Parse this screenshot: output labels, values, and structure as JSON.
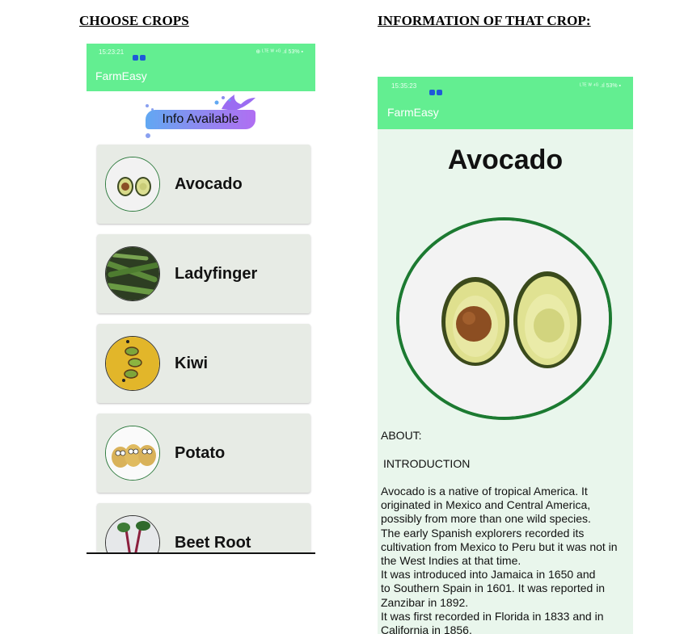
{
  "headings": {
    "left": "CHOOSE CROPS",
    "right": "INFORMATION OF THAT CROP:"
  },
  "list_screen": {
    "status_time": "15:23:21",
    "status_right": "⊕ ᴸᵀᴱ ᵂ ⁴ᴳ .ıl 53% ▪",
    "app_title": "FarmEasy",
    "banner": "Info Available",
    "crops": [
      {
        "name": "Avocado",
        "icon": "avocado-image"
      },
      {
        "name": "Ladyfinger",
        "icon": "okra-image"
      },
      {
        "name": "Kiwi",
        "icon": "kiwi-image"
      },
      {
        "name": "Potato",
        "icon": "potato-image"
      },
      {
        "name": "Beet Root",
        "icon": "beetroot-image"
      }
    ]
  },
  "detail_screen": {
    "status_time": "15:35:23",
    "status_right": "ᴸᵀᴱ ᵂ ⁴ᴳ .ıl 53% ▪",
    "app_title": "FarmEasy",
    "crop_title": "Avocado",
    "about_label": "ABOUT:",
    "intro_label": "INTRODUCTION",
    "body": " Avocado is a native of tropical America. It\noriginated in Mexico and Central America,\npossibly from more than one wild species.\n The early Spanish explorers recorded its\ncultivation from Mexico to Peru but it was not in\nthe West Indies at that time.\n It was introduced into Jamaica in 1650 and\nto Southern Spain in 1601. It was reported in\nZanzibar in 1892.\n It was first recorded in Florida in 1833 and in\nCalifornia in 1856."
  },
  "colors": {
    "app_green": "#63ee91",
    "card_bg": "#e7ebe5",
    "circle_border": "#2f7b3f",
    "detail_bg": "#e9f6ec"
  }
}
